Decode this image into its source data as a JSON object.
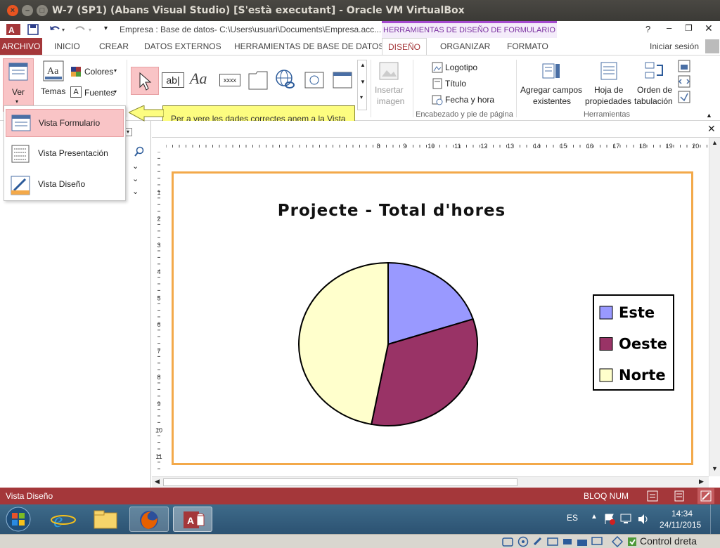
{
  "window": {
    "title": "W-7 (SP1) (Abans Visual Studio) [S'està executant] - Oracle VM VirtualBox"
  },
  "qat": {
    "document": "Empresa : Base de datos- C:\\Users\\usuari\\Documents\\Empresa.acc...",
    "context_tab": "HERRAMIENTAS DE DISEÑO DE FORMULARIO",
    "help": "?"
  },
  "tabs": {
    "archivo": "ARCHIVO",
    "inicio": "INICIO",
    "crear": "CREAR",
    "datos_externos": "DATOS EXTERNOS",
    "herramientas_bd": "HERRAMIENTAS DE BASE DE DATOS",
    "diseno": "DISEÑO",
    "organizar": "ORGANIZAR",
    "formato": "FORMATO",
    "signin": "Iniciar sesión"
  },
  "ribbon": {
    "ver": "Ver",
    "temas": "Temas",
    "colores": "Colores",
    "fuentes": "Fuentes",
    "insertar_imagen_1": "Insertar",
    "insertar_imagen_2": "imagen",
    "logotipo": "Logotipo",
    "titulo": "Título",
    "fecha_hora": "Fecha y hora",
    "agregar_campos_1": "Agregar campos",
    "agregar_campos_2": "existentes",
    "hoja_prop_1": "Hoja de",
    "hoja_prop_2": "propiedades",
    "orden_tab_1": "Orden de",
    "orden_tab_2": "tabulación",
    "group_encabezado": "Encabezado y pie de página",
    "group_herramientas": "Herramientas",
    "text_ab": "ab|",
    "text_aa": "Aa",
    "text_xxxx": "xxxx"
  },
  "view_menu": {
    "formulario": "Vista Formulario",
    "presentacion": "Vista Presentación",
    "diseno": "Vista Diseño"
  },
  "callout": {
    "text": "Per a vere les dades correctes anem a la Vista Formulari"
  },
  "ruler": {
    "h": [
      "8",
      "9",
      "10",
      "11",
      "12",
      "13",
      "14",
      "15",
      "16",
      "17",
      "18",
      "19",
      "20"
    ],
    "v": [
      "1",
      "2",
      "3",
      "4",
      "5",
      "6",
      "7",
      "8",
      "9",
      "10",
      "11"
    ]
  },
  "chart_data": {
    "type": "pie",
    "title": "Projecte - Total d'hores",
    "slices": [
      {
        "label": "Este",
        "value": 20,
        "color": "#9999ff"
      },
      {
        "label": "Oeste",
        "value": 33,
        "color": "#993366"
      },
      {
        "label": "Norte",
        "value": 47,
        "color": "#ffffcc"
      }
    ],
    "legend_position": "right"
  },
  "statusbar": {
    "left": "Vista Diseño",
    "bloq_num": "BLOQ NUM"
  },
  "taskbar": {
    "lang": "ES",
    "time": "14:34",
    "date": "24/11/2015"
  },
  "vbox": {
    "host_key": "Control dreta"
  },
  "colors": {
    "access_red": "#a4373a",
    "context_purple": "#a64ad0",
    "callout_yellow": "#fdfd80",
    "form_border": "#f3a94a"
  }
}
